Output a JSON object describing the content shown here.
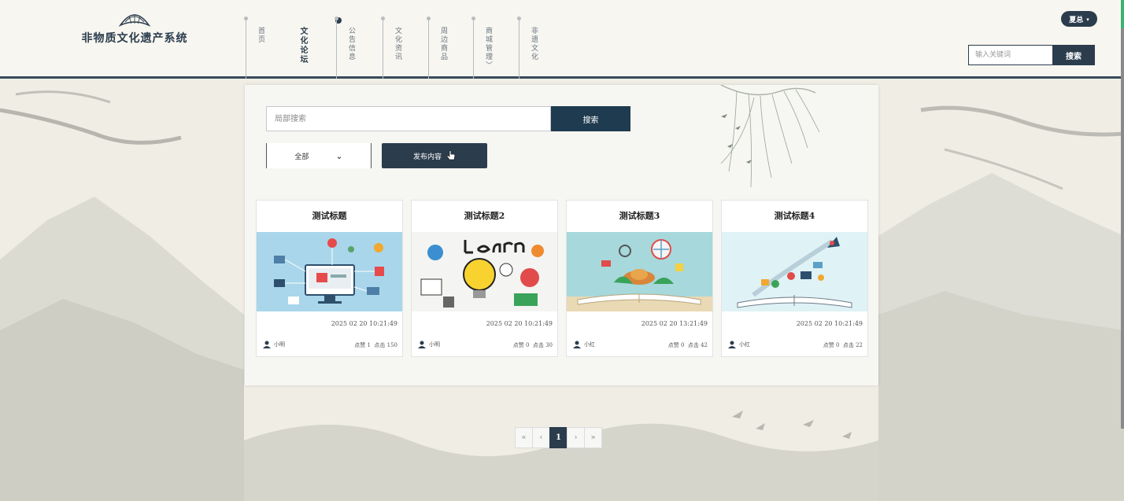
{
  "header": {
    "site_title": "非物质文化遗产系统",
    "nav": [
      {
        "label": "首页"
      },
      {
        "label": "文化论坛",
        "active": true
      },
      {
        "label": "公告信息"
      },
      {
        "label": "文化资讯"
      },
      {
        "label": "周边商品"
      },
      {
        "label": "商城管理〉"
      },
      {
        "label": "非遗文化"
      }
    ],
    "user_label": "夏总",
    "search_placeholder": "输入关键词",
    "search_button": "搜索"
  },
  "forum": {
    "local_search_placeholder": "局部搜索",
    "local_search_button": "搜索",
    "category_selected": "全部",
    "publish_button": "发布内容",
    "posts": [
      {
        "title": "测试标题",
        "time": "2025 02 20 10:21:49",
        "author": "小明",
        "likes_label": "点赞 1",
        "views_label": "点击 150"
      },
      {
        "title": "测试标题2",
        "time": "2025 02 20 10:21:49",
        "author": "小明",
        "likes_label": "点赞 0",
        "views_label": "点击 30"
      },
      {
        "title": "测试标题3",
        "time": "2025 02 20 13:21:49",
        "author": "小红",
        "likes_label": "点赞 0",
        "views_label": "点击 42"
      },
      {
        "title": "测试标题4",
        "time": "2025 02 20 10:21:49",
        "author": "小红",
        "likes_label": "点赞 0",
        "views_label": "点击 22"
      }
    ],
    "card_images": [
      "illustration-ecommerce",
      "illustration-learn",
      "illustration-book-travel",
      "illustration-book-win"
    ]
  },
  "pagination": {
    "first": "«",
    "prev": "‹",
    "current": "1",
    "next": "›",
    "last": "»"
  },
  "colors": {
    "primary": "#2b3c4d",
    "search_button": "#1f3b4f",
    "background": "#efede4"
  }
}
